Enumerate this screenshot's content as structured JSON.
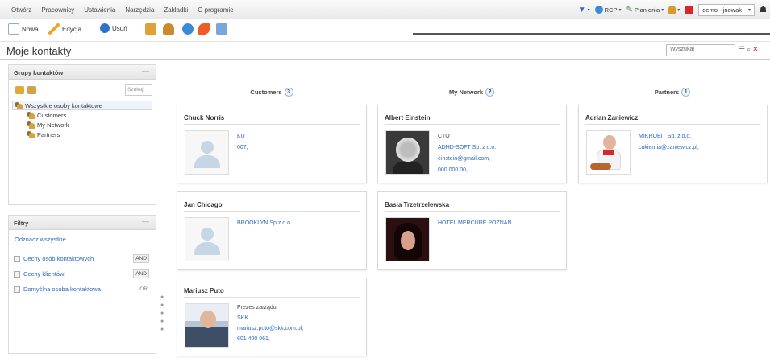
{
  "menu": {
    "items": [
      "Otwórz",
      "Pracownicy",
      "Ustawienia",
      "Narzędzia",
      "Zakładki",
      "O programie"
    ]
  },
  "topright": {
    "rcp": "RCP",
    "plan": "Plan dnia",
    "user_select": "demo - jnowak"
  },
  "toolbar": {
    "new_label": "Nowa",
    "edit_label": "Edycja",
    "delete_label": "Usuń"
  },
  "page": {
    "title": "Moje kontakty",
    "search_placeholder": "Wyszukaj"
  },
  "groups_panel": {
    "title": "Grupy kontaktów",
    "search_placeholder": "Szukaj",
    "root": "Wszystkie osoby kontaktowe",
    "children": [
      "Customers",
      "My Network",
      "Partners"
    ]
  },
  "filters_panel": {
    "title": "Filtry",
    "clear_all": "Odznacz wszystkie",
    "filters": [
      {
        "label": "Cechy osób kontaktowych",
        "op": "AND"
      },
      {
        "label": "Cechy klientów",
        "op": "AND"
      },
      {
        "label": "Domyślna osoba kontaktowa",
        "op": "OR"
      }
    ]
  },
  "columns": [
    {
      "title": "Customers",
      "count": "3"
    },
    {
      "title": "My Network",
      "count": "2"
    },
    {
      "title": "Partners",
      "count": "1"
    }
  ],
  "cards": {
    "chuck": {
      "name": "Chuck Norris",
      "lines": [
        "KU",
        "007,"
      ]
    },
    "jan": {
      "name": "Jan Chicago",
      "lines": [
        "BROOKLYN Sp.z o.o."
      ]
    },
    "mariusz": {
      "name": "Mariusz Puto",
      "title": "Prezes zarządu",
      "lines": [
        "SKK",
        "mariusz.puto@skk.com.pl,",
        "601 400 061,"
      ]
    },
    "albert": {
      "name": "Albert Einstein",
      "title": "CTO",
      "lines": [
        "ADHD-SOFT Sp. z o.o.",
        "einstein@gmail.com,",
        "000 000 00,"
      ]
    },
    "basia": {
      "name": "Basia Trzetrzelewska",
      "lines": [
        "HOTEL MERCURE POZNAŃ"
      ]
    },
    "adrian": {
      "name": "Adrian Zaniewicz",
      "lines": [
        "MIKROBIT Sp. z o.o.",
        "cukiernia@zaniewicz.pl,"
      ]
    }
  }
}
